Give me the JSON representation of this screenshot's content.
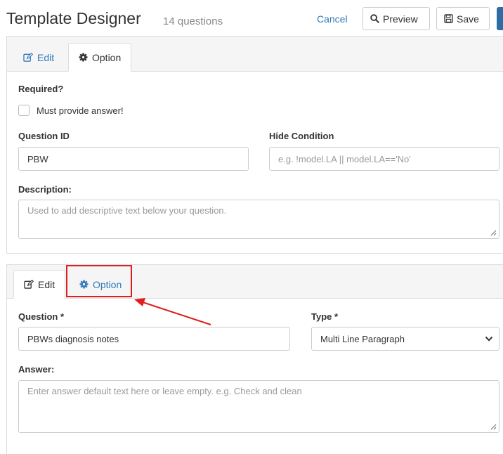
{
  "header": {
    "title": "Template Designer",
    "subtitle": "14 questions",
    "cancel_label": "Cancel",
    "preview_label": "Preview",
    "save_label": "Save"
  },
  "panel1": {
    "tabs": [
      {
        "label": "Edit",
        "icon": "edit-icon"
      },
      {
        "label": "Option",
        "icon": "gear-icon"
      }
    ],
    "active_tab": "Option",
    "required_label": "Required?",
    "must_provide_label": "Must provide answer!",
    "must_provide_checked": false,
    "question_id_label": "Question ID",
    "question_id_value": "PBW",
    "hide_condition_label": "Hide Condition",
    "hide_condition_placeholder": "e.g. !model.LA || model.LA=='No'",
    "description_label": "Description:",
    "description_placeholder": "Used to add descriptive text below your question."
  },
  "panel2": {
    "tabs": [
      {
        "label": "Edit",
        "icon": "edit-icon"
      },
      {
        "label": "Option",
        "icon": "gear-icon"
      }
    ],
    "active_tab": "Edit",
    "question_label": "Question *",
    "question_value": "PBWs diagnosis notes",
    "type_label": "Type *",
    "type_value": "Multi Line Paragraph",
    "answer_label": "Answer:",
    "answer_placeholder": "Enter answer default text here or leave empty. e.g. Check and clean"
  },
  "colors": {
    "link": "#337ab7",
    "annotation": "#e11d1d",
    "border": "#dddddd",
    "tabbar_bg": "#f5f5f5"
  }
}
